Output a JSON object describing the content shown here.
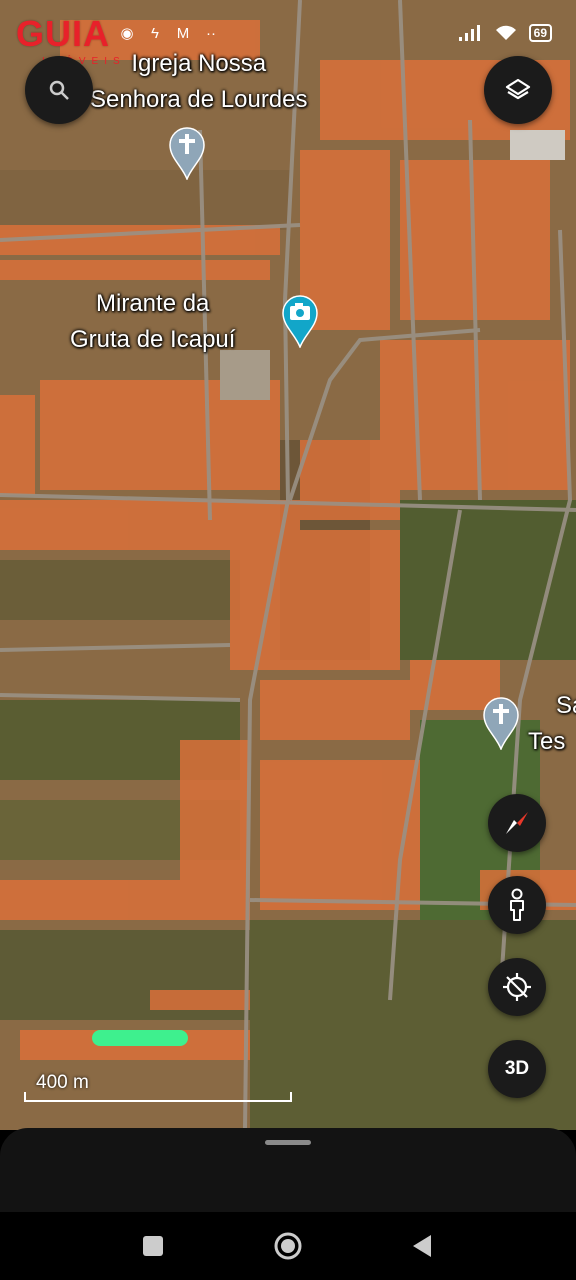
{
  "status_bar": {
    "battery": "69"
  },
  "logo": {
    "main": "GUIA",
    "sub": "IMÓVEIS"
  },
  "map": {
    "labels": [
      {
        "id": "church-top",
        "line1": "Igreja Nossa",
        "line2": "Senhora de Lourdes"
      },
      {
        "id": "mirante",
        "line1": "Mirante da",
        "line2": "Gruta de Icapuí"
      },
      {
        "id": "church-right",
        "line1": "Sa",
        "line2": "Tes"
      }
    ],
    "scale_label": "400 m",
    "colors": {
      "terrain": "#8a6a45",
      "roofs": "#d9703a",
      "vegetation": "#3f5a2a",
      "highlight": "#3ef08e",
      "pin_church": "#8fa6b8",
      "pin_camera": "#12a6c9"
    }
  },
  "controls": {
    "search_icon": "search-icon",
    "layers_icon": "layers-icon",
    "compass_icon": "compass-icon",
    "pegman_icon": "pegman-icon",
    "location_icon": "location-off-icon",
    "three_d_label": "3D"
  },
  "navbar": {
    "icons": [
      "square-icon",
      "circle-icon",
      "back-triangle-icon"
    ]
  }
}
